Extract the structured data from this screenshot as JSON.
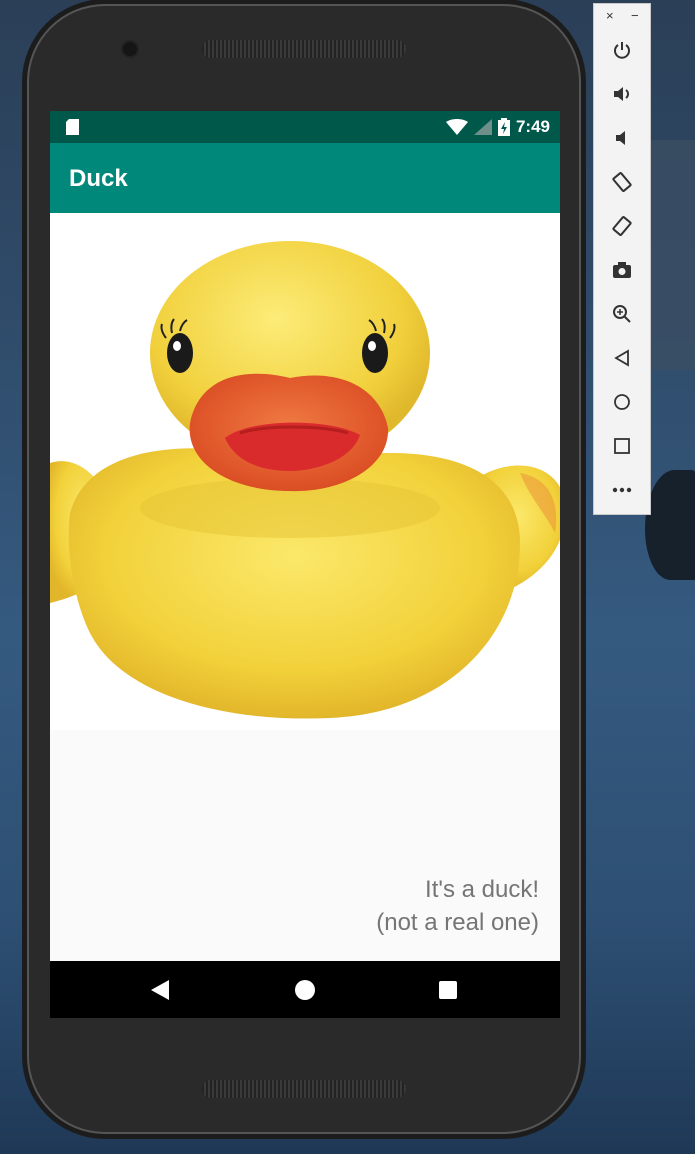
{
  "app": {
    "title": "Duck",
    "caption_line1": "It's a duck!",
    "caption_line2": "(not a real one)"
  },
  "status_bar": {
    "time": "7:49",
    "icons": [
      "sd-card-icon",
      "wifi-icon",
      "cell-signal-icon",
      "battery-charging-icon"
    ]
  },
  "nav_bar": {
    "buttons": [
      "back-icon",
      "home-icon",
      "recents-icon"
    ]
  },
  "emulator_toolbar": {
    "window_controls": [
      "×",
      "−"
    ],
    "buttons": [
      "power-icon",
      "volume-up-icon",
      "volume-down-icon",
      "rotate-left-icon",
      "rotate-right-icon",
      "camera-icon",
      "zoom-icon",
      "back-icon",
      "home-icon",
      "overview-icon",
      "more-icon"
    ]
  },
  "colors": {
    "status_bar": "#00584a",
    "app_bar": "#00897b",
    "duck_body": "#f4d43f",
    "duck_beak": "#e8542a",
    "caption_text": "#757575"
  }
}
